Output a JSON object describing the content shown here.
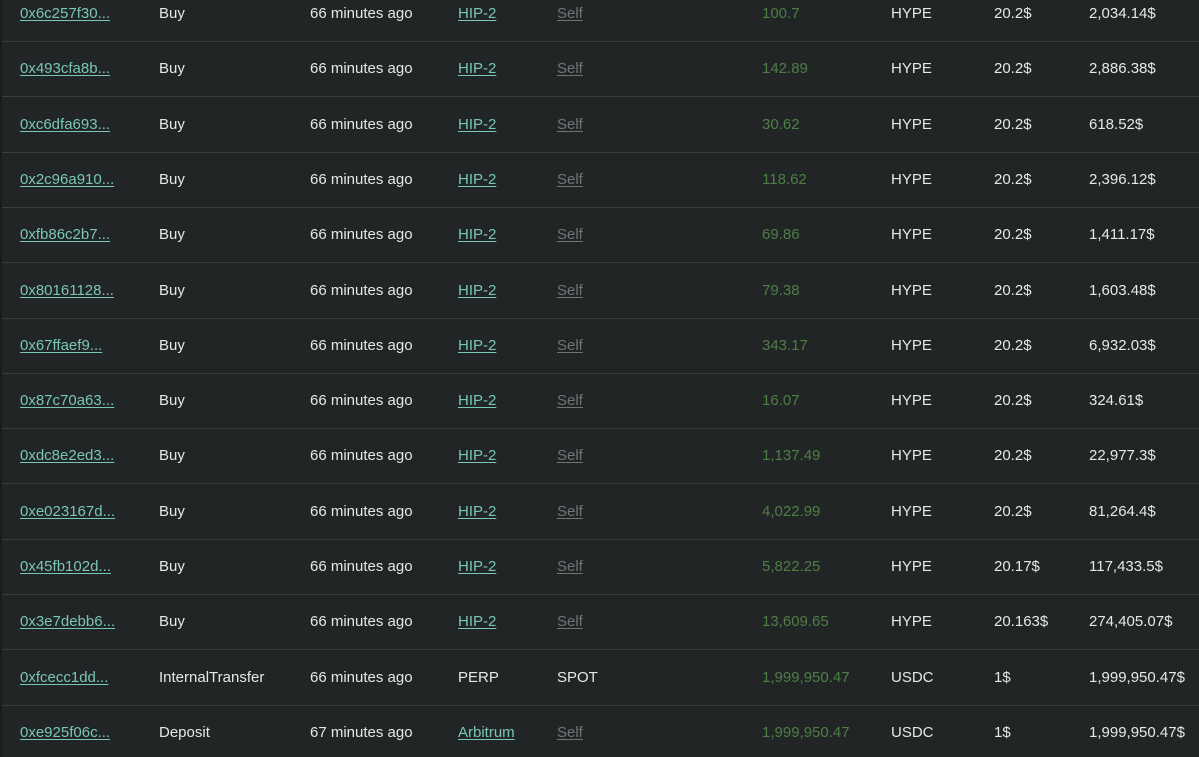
{
  "rows": [
    {
      "hash": "0x6c257f30...",
      "action": "Buy",
      "time": "66 minutes ago",
      "source": "HIP-2",
      "source_link": true,
      "dest": "Self",
      "dest_link": true,
      "amount": "100.7",
      "token": "HYPE",
      "price": "20.2$",
      "value": "2,034.14$"
    },
    {
      "hash": "0x493cfa8b...",
      "action": "Buy",
      "time": "66 minutes ago",
      "source": "HIP-2",
      "source_link": true,
      "dest": "Self",
      "dest_link": true,
      "amount": "142.89",
      "token": "HYPE",
      "price": "20.2$",
      "value": "2,886.38$"
    },
    {
      "hash": "0xc6dfa693...",
      "action": "Buy",
      "time": "66 minutes ago",
      "source": "HIP-2",
      "source_link": true,
      "dest": "Self",
      "dest_link": true,
      "amount": "30.62",
      "token": "HYPE",
      "price": "20.2$",
      "value": "618.52$"
    },
    {
      "hash": "0x2c96a910...",
      "action": "Buy",
      "time": "66 minutes ago",
      "source": "HIP-2",
      "source_link": true,
      "dest": "Self",
      "dest_link": true,
      "amount": "118.62",
      "token": "HYPE",
      "price": "20.2$",
      "value": "2,396.12$"
    },
    {
      "hash": "0xfb86c2b7...",
      "action": "Buy",
      "time": "66 minutes ago",
      "source": "HIP-2",
      "source_link": true,
      "dest": "Self",
      "dest_link": true,
      "amount": "69.86",
      "token": "HYPE",
      "price": "20.2$",
      "value": "1,411.17$"
    },
    {
      "hash": "0x80161128...",
      "action": "Buy",
      "time": "66 minutes ago",
      "source": "HIP-2",
      "source_link": true,
      "dest": "Self",
      "dest_link": true,
      "amount": "79.38",
      "token": "HYPE",
      "price": "20.2$",
      "value": "1,603.48$"
    },
    {
      "hash": "0x67ffaef9...",
      "action": "Buy",
      "time": "66 minutes ago",
      "source": "HIP-2",
      "source_link": true,
      "dest": "Self",
      "dest_link": true,
      "amount": "343.17",
      "token": "HYPE",
      "price": "20.2$",
      "value": "6,932.03$"
    },
    {
      "hash": "0x87c70a63...",
      "action": "Buy",
      "time": "66 minutes ago",
      "source": "HIP-2",
      "source_link": true,
      "dest": "Self",
      "dest_link": true,
      "amount": "16.07",
      "token": "HYPE",
      "price": "20.2$",
      "value": "324.61$"
    },
    {
      "hash": "0xdc8e2ed3...",
      "action": "Buy",
      "time": "66 minutes ago",
      "source": "HIP-2",
      "source_link": true,
      "dest": "Self",
      "dest_link": true,
      "amount": "1,137.49",
      "token": "HYPE",
      "price": "20.2$",
      "value": "22,977.3$"
    },
    {
      "hash": "0xe023167d...",
      "action": "Buy",
      "time": "66 minutes ago",
      "source": "HIP-2",
      "source_link": true,
      "dest": "Self",
      "dest_link": true,
      "amount": "4,022.99",
      "token": "HYPE",
      "price": "20.2$",
      "value": "81,264.4$"
    },
    {
      "hash": "0x45fb102d...",
      "action": "Buy",
      "time": "66 minutes ago",
      "source": "HIP-2",
      "source_link": true,
      "dest": "Self",
      "dest_link": true,
      "amount": "5,822.25",
      "token": "HYPE",
      "price": "20.17$",
      "value": "117,433.5$"
    },
    {
      "hash": "0x3e7debb6...",
      "action": "Buy",
      "time": "66 minutes ago",
      "source": "HIP-2",
      "source_link": true,
      "dest": "Self",
      "dest_link": true,
      "amount": "13,609.65",
      "token": "HYPE",
      "price": "20.163$",
      "value": "274,405.07$"
    },
    {
      "hash": "0xfcecc1dd...",
      "action": "InternalTransfer",
      "time": "66 minutes ago",
      "source": "PERP",
      "source_link": false,
      "dest": "SPOT",
      "dest_link": false,
      "amount": "1,999,950.47",
      "token": "USDC",
      "price": "1$",
      "value": "1,999,950.47$"
    },
    {
      "hash": "0xe925f06c...",
      "action": "Deposit",
      "time": "67 minutes ago",
      "source": "Arbitrum",
      "source_link": true,
      "dest": "Self",
      "dest_link": true,
      "amount": "1,999,950.47",
      "token": "USDC",
      "price": "1$",
      "value": "1,999,950.47$"
    }
  ],
  "colors": {
    "background": "#222526",
    "row_divider": "#3a3d3e",
    "link_teal": "#79c6b5",
    "link_grey": "#6f7475",
    "amount_green": "#4d7f44",
    "text": "#e6e8e8"
  }
}
